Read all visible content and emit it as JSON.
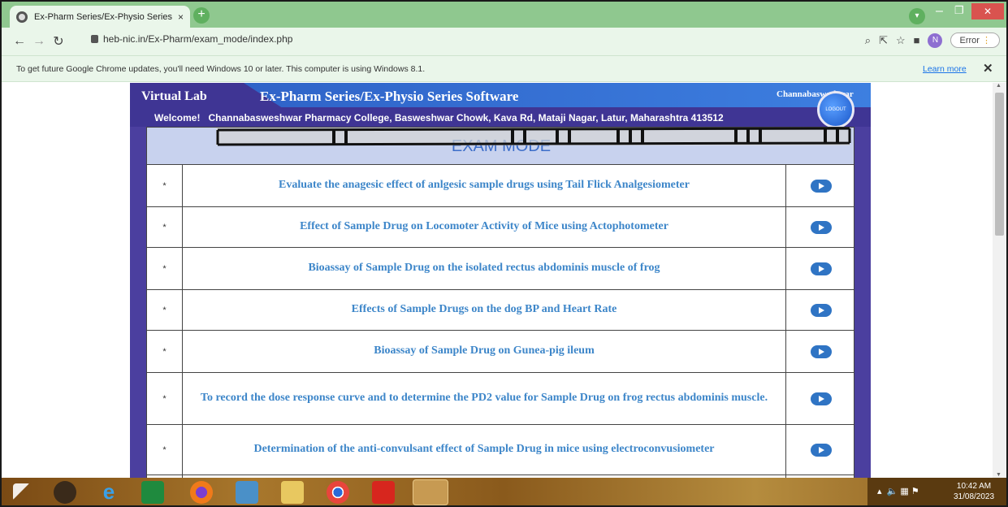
{
  "browser": {
    "tab_title": "Ex-Pharm Series/Ex-Physio Series",
    "tab_close": "×",
    "new_tab": "+",
    "url": "heb-nic.in/Ex-Pharm/exam_mode/index.php",
    "error_label": "Error",
    "avatar_letter": "N",
    "info_text": "To get future Google Chrome updates, you'll need Windows 10 or later. This computer is using Windows 8.1.",
    "learn_more": "Learn more",
    "info_close": "✕"
  },
  "site": {
    "brand": "Virtual Lab",
    "app_title": "Ex-Pharm Series/Ex-Physio Series Software",
    "user_name": "Channabasweshwar",
    "logout_label": "LOGOUT",
    "welcome_label": "Welcome!",
    "college": "Channabasweshwar Pharmacy College, Basweshwar Chowk, Kava Rd, Mataji Nagar, Latur, Maharashtra 413512",
    "exam_title": "EXAM MODE"
  },
  "experiments": [
    {
      "bullet": "*",
      "title": "Evaluate the anagesic effect of anlgesic sample drugs using Tail Flick Analgesiometer"
    },
    {
      "bullet": "*",
      "title": "Effect of Sample Drug on Locomoter Activity of Mice using Actophotometer"
    },
    {
      "bullet": "*",
      "title": "Bioassay of Sample Drug on the isolated rectus abdominis muscle of frog"
    },
    {
      "bullet": "*",
      "title": "Effects of Sample Drugs on the dog BP and Heart Rate"
    },
    {
      "bullet": "*",
      "title": "Bioassay of Sample Drug on Gunea-pig ileum"
    },
    {
      "bullet": "*",
      "title": "To record the dose response curve and to determine the PD2 value for Sample Drug on frog rectus abdominis muscle."
    },
    {
      "bullet": "*",
      "title": "Determination of the anti-convulsant effect of Sample Drug in mice using electroconvusiometer"
    },
    {
      "bullet": "",
      "title": ""
    }
  ],
  "taskbar": {
    "time": "10:42 AM",
    "date": "31/08/2023"
  },
  "colors": {
    "chrome_green": "#8fc88f",
    "lab_purple": "#4b3f9f",
    "link_blue": "#3d86c9"
  }
}
